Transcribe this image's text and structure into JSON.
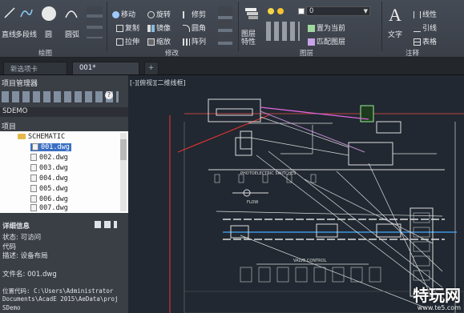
{
  "ribbon": {
    "draw": {
      "line": "直线",
      "polyline": "多段线",
      "circle": "圆",
      "arc": "圆弧",
      "panel": "绘图"
    },
    "modify": {
      "move": "移动",
      "rotate": "旋转",
      "trim": "修剪",
      "copy": "复制",
      "mirror": "镜像",
      "fillet": "圆角",
      "stretch": "拉伸",
      "scale": "缩放",
      "array": "阵列",
      "panel": "修改"
    },
    "layers": {
      "layer_props": "图层特性",
      "set_current": "置为当前",
      "match_layer": "匹配图层",
      "layer_value": "0",
      "panel": "图层"
    },
    "annotation": {
      "text": "文字",
      "linear": "线性",
      "leader": "引线",
      "table": "表格",
      "panel": "注释"
    }
  },
  "tabs": [
    {
      "label": "新选项卡"
    },
    {
      "label": "001*"
    },
    {
      "label": "+"
    }
  ],
  "left": {
    "title": "项目管理器",
    "project_name": "SDEMO",
    "section_label": "项目",
    "tree": {
      "root": "SCHEMATIC",
      "items": [
        "001.dwg",
        "002.dwg",
        "003.dwg",
        "004.dwg",
        "005.dwg",
        "006.dwg",
        "007.dwg"
      ]
    },
    "details": {
      "title": "详细信息",
      "status": "状态: 可访问",
      "code": "代码",
      "desc": "描述: 设备布局",
      "filename": "文件名: 001.dwg",
      "location": "位置代码: C:\\Users\\Administrator",
      "path": "Documents\\AcadE 2015\\AeData\\proj",
      "project": "SDemo"
    }
  },
  "drawing": {
    "viewport_label": "[-][俯视][二维线框]",
    "photo_label": "PHOTOELECTRIC SWITCHES",
    "flow": "FLOW",
    "valve": "VALVE CONTROL"
  },
  "watermark": {
    "brand": "特玩网",
    "domain": "www.te5.com"
  }
}
